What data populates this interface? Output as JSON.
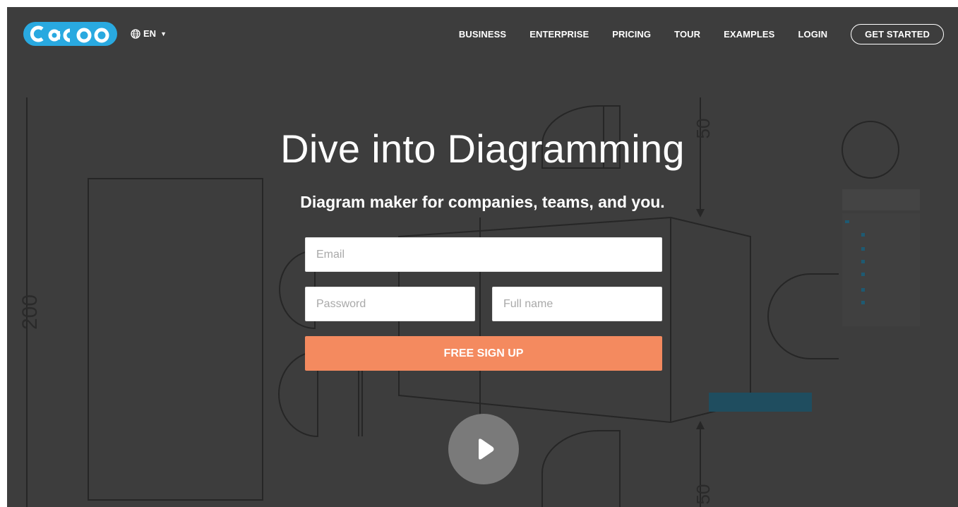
{
  "header": {
    "logo_text": "Cacoo",
    "language": "EN",
    "nav": [
      "BUSINESS",
      "ENTERPRISE",
      "PRICING",
      "TOUR",
      "EXAMPLES",
      "LOGIN"
    ],
    "cta": "GET STARTED"
  },
  "hero": {
    "title": "Dive into Diagramming",
    "subtitle": "Diagram maker for companies, teams, and you."
  },
  "form": {
    "email_placeholder": "Email",
    "password_placeholder": "Password",
    "fullname_placeholder": "Full name",
    "signup_label": "FREE SIGN UP"
  },
  "background": {
    "dimension_left": "200",
    "dimension_top": "50",
    "dimension_bottom": "50"
  },
  "colors": {
    "overlay": "#3d3d3d",
    "accent": "#f48a5f",
    "logo_blue": "#29a9e0"
  }
}
